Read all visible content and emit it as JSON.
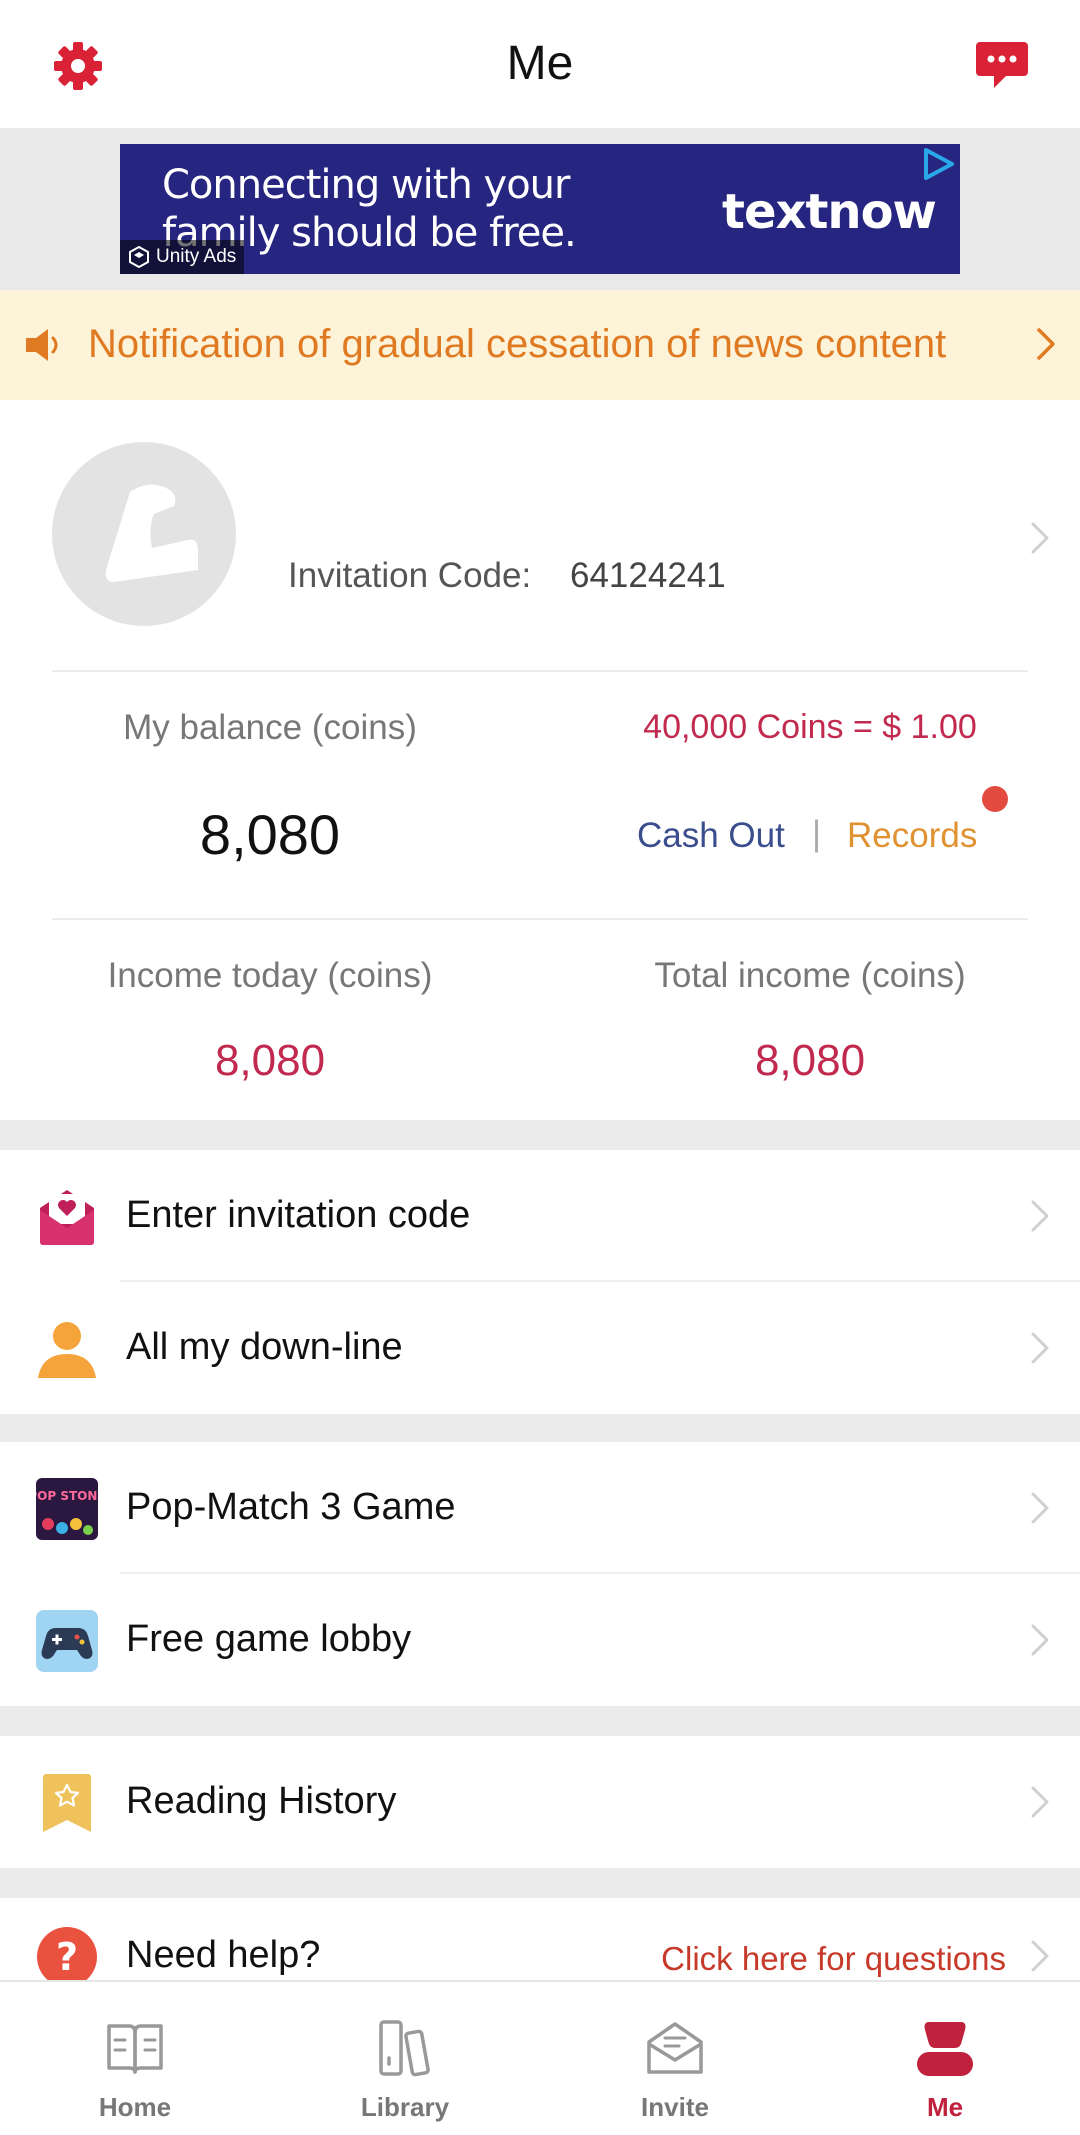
{
  "header": {
    "title": "Me"
  },
  "ad": {
    "line1": "Connecting with your",
    "line2": "family should be free.",
    "brand": "textnow",
    "network": "Unity Ads"
  },
  "notice": {
    "text": "Notification of gradual cessation of news content"
  },
  "profile": {
    "invitation_label": "Invitation Code:",
    "invitation_code": "64124241"
  },
  "balance": {
    "label": "My balance (coins)",
    "rate": "40,000 Coins = $ 1.00",
    "value": "8,080",
    "cash_out": "Cash Out",
    "separator": "|",
    "records": "Records",
    "income_today_label": "Income today (coins)",
    "income_today_value": "8,080",
    "total_income_label": "Total income (coins)",
    "total_income_value": "8,080"
  },
  "menu": {
    "enter_invitation_code": "Enter invitation code",
    "all_downline": "All my down-line",
    "pop_match_game": "Pop-Match 3 Game",
    "free_game_lobby": "Free game lobby",
    "reading_history": "Reading History",
    "need_help": "Need help?",
    "need_help_link": "Click here for questions",
    "game_icon_text": "POP STONE"
  },
  "tabs": [
    {
      "label": "Home",
      "icon": "book-open-icon"
    },
    {
      "label": "Library",
      "icon": "library-icon"
    },
    {
      "label": "Invite",
      "icon": "envelope-icon"
    },
    {
      "label": "Me",
      "icon": "person-icon",
      "active": true
    }
  ],
  "colors": {
    "accent": "#c0213c",
    "notice_bg": "#fdf3d9",
    "notice_text": "#e07a22",
    "cash_out": "#3a4d8c",
    "records": "#e09130"
  }
}
